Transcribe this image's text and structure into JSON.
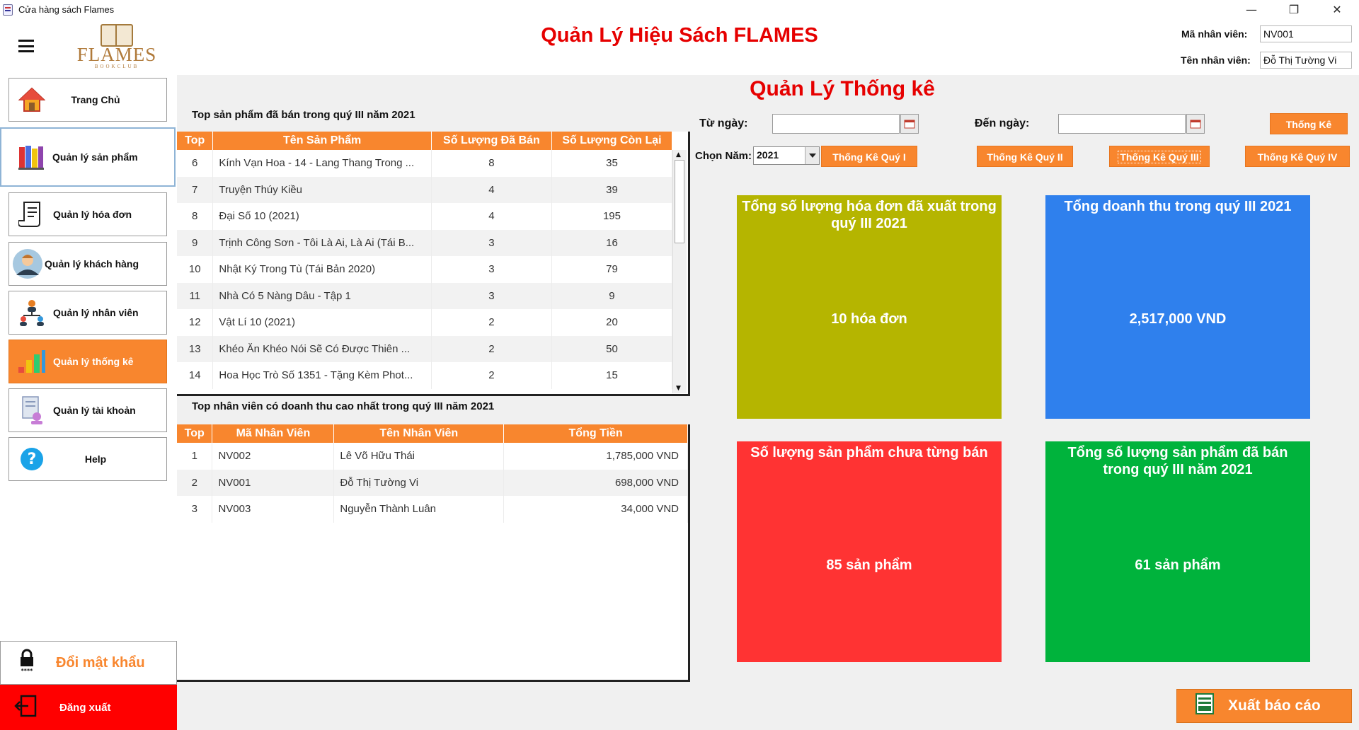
{
  "window": {
    "title": "Cửa hàng sách Flames",
    "minimize": "—",
    "maximize": "❐",
    "close": "✕"
  },
  "header": {
    "logo_text": "FLAMES",
    "logo_sub": "BOOKCLUB",
    "title": "Quản Lý Hiệu Sách FLAMES",
    "employee_id_label": "Mã nhân viên:",
    "employee_id": "NV001",
    "employee_name_label": "Tên nhân viên:",
    "employee_name": "Đỗ Thị Tường Vi"
  },
  "sidebar": {
    "items": [
      {
        "label": "Trang Chủ",
        "icon": "home-icon"
      },
      {
        "label": "Quản lý sản phẩm",
        "icon": "books-icon"
      },
      {
        "label": "Quản lý hóa đơn",
        "icon": "invoice-icon"
      },
      {
        "label": "Quản lý khách hàng",
        "icon": "customer-icon"
      },
      {
        "label": "Quản lý nhân viên",
        "icon": "staff-icon"
      },
      {
        "label": "Quản lý thống kê",
        "icon": "chart-icon"
      },
      {
        "label": "Quản lý tài khoản",
        "icon": "account-icon"
      },
      {
        "label": "Help",
        "icon": "help-icon"
      }
    ],
    "change_password": "Đổi mật khẩu",
    "logout": "Đăng xuất"
  },
  "page_title": "Quản Lý Thống kê",
  "top_products": {
    "title": "Top sản phẩm đã bán trong quý III năm 2021",
    "columns": [
      "Top",
      "Tên Sản Phẩm",
      "Số Lượng Đã Bán",
      "Số Lượng Còn Lại"
    ],
    "rows": [
      [
        "6",
        "Kính Vạn Hoa - 14 - Lang Thang Trong ...",
        "8",
        "35"
      ],
      [
        "7",
        "Truyện Thúy Kiều",
        "4",
        "39"
      ],
      [
        "8",
        "Đại Số 10 (2021)",
        "4",
        "195"
      ],
      [
        "9",
        "Trịnh Công Sơn - Tôi Là Ai, Là Ai (Tái B...",
        "3",
        "16"
      ],
      [
        "10",
        "Nhật Ký Trong Tù (Tái Bản 2020)",
        "3",
        "79"
      ],
      [
        "11",
        "Nhà Có 5 Nàng Dâu - Tập 1",
        "3",
        "9"
      ],
      [
        "12",
        "Vật Lí 10 (2021)",
        "2",
        "20"
      ],
      [
        "13",
        "Khéo Ăn Khéo Nói Sẽ Có Được Thiên ...",
        "2",
        "50"
      ],
      [
        "14",
        "Hoa Học Trò Số 1351 - Tặng Kèm Phot...",
        "2",
        "15"
      ]
    ]
  },
  "top_employees": {
    "title": "Top nhân viên có doanh thu cao nhất trong quý III năm 2021",
    "columns": [
      "Top",
      "Mã Nhân Viên",
      "Tên Nhân Viên",
      "Tổng Tiền"
    ],
    "rows": [
      [
        "1",
        "NV002",
        "Lê Võ Hữu Thái",
        "1,785,000 VND"
      ],
      [
        "2",
        "NV001",
        "Đỗ Thị Tường Vi",
        "698,000 VND"
      ],
      [
        "3",
        "NV003",
        "Nguyễn Thành Luân",
        "34,000 VND"
      ]
    ]
  },
  "filters": {
    "from_label": "Từ ngày:",
    "from_value": "",
    "to_label": "Đến ngày:",
    "to_value": "",
    "stat_button": "Thống Kê",
    "year_label": "Chọn Năm:",
    "year_value": "2021",
    "q1": "Thống Kê Quý I",
    "q2": "Thống Kê Quý II",
    "q3": "Thống Kê Quý III",
    "q4": "Thống Kê Quý IV"
  },
  "cards": [
    {
      "title": "Tổng số lượng hóa đơn đã xuất trong quý III 2021",
      "value": "10 hóa đơn",
      "color": "#b5b500"
    },
    {
      "title": "Tổng doanh thu trong quý III 2021",
      "value": "2,517,000 VND",
      "color": "#2f80ed"
    },
    {
      "title": "Số lượng sản phẩm chưa từng bán",
      "value": "85 sản phẩm",
      "color": "#ff3333"
    },
    {
      "title": "Tổng số lượng sản phẩm đã bán trong quý III năm 2021",
      "value": "61 sản phẩm",
      "color": "#00b33c"
    }
  ],
  "export_button": "Xuất báo cáo"
}
